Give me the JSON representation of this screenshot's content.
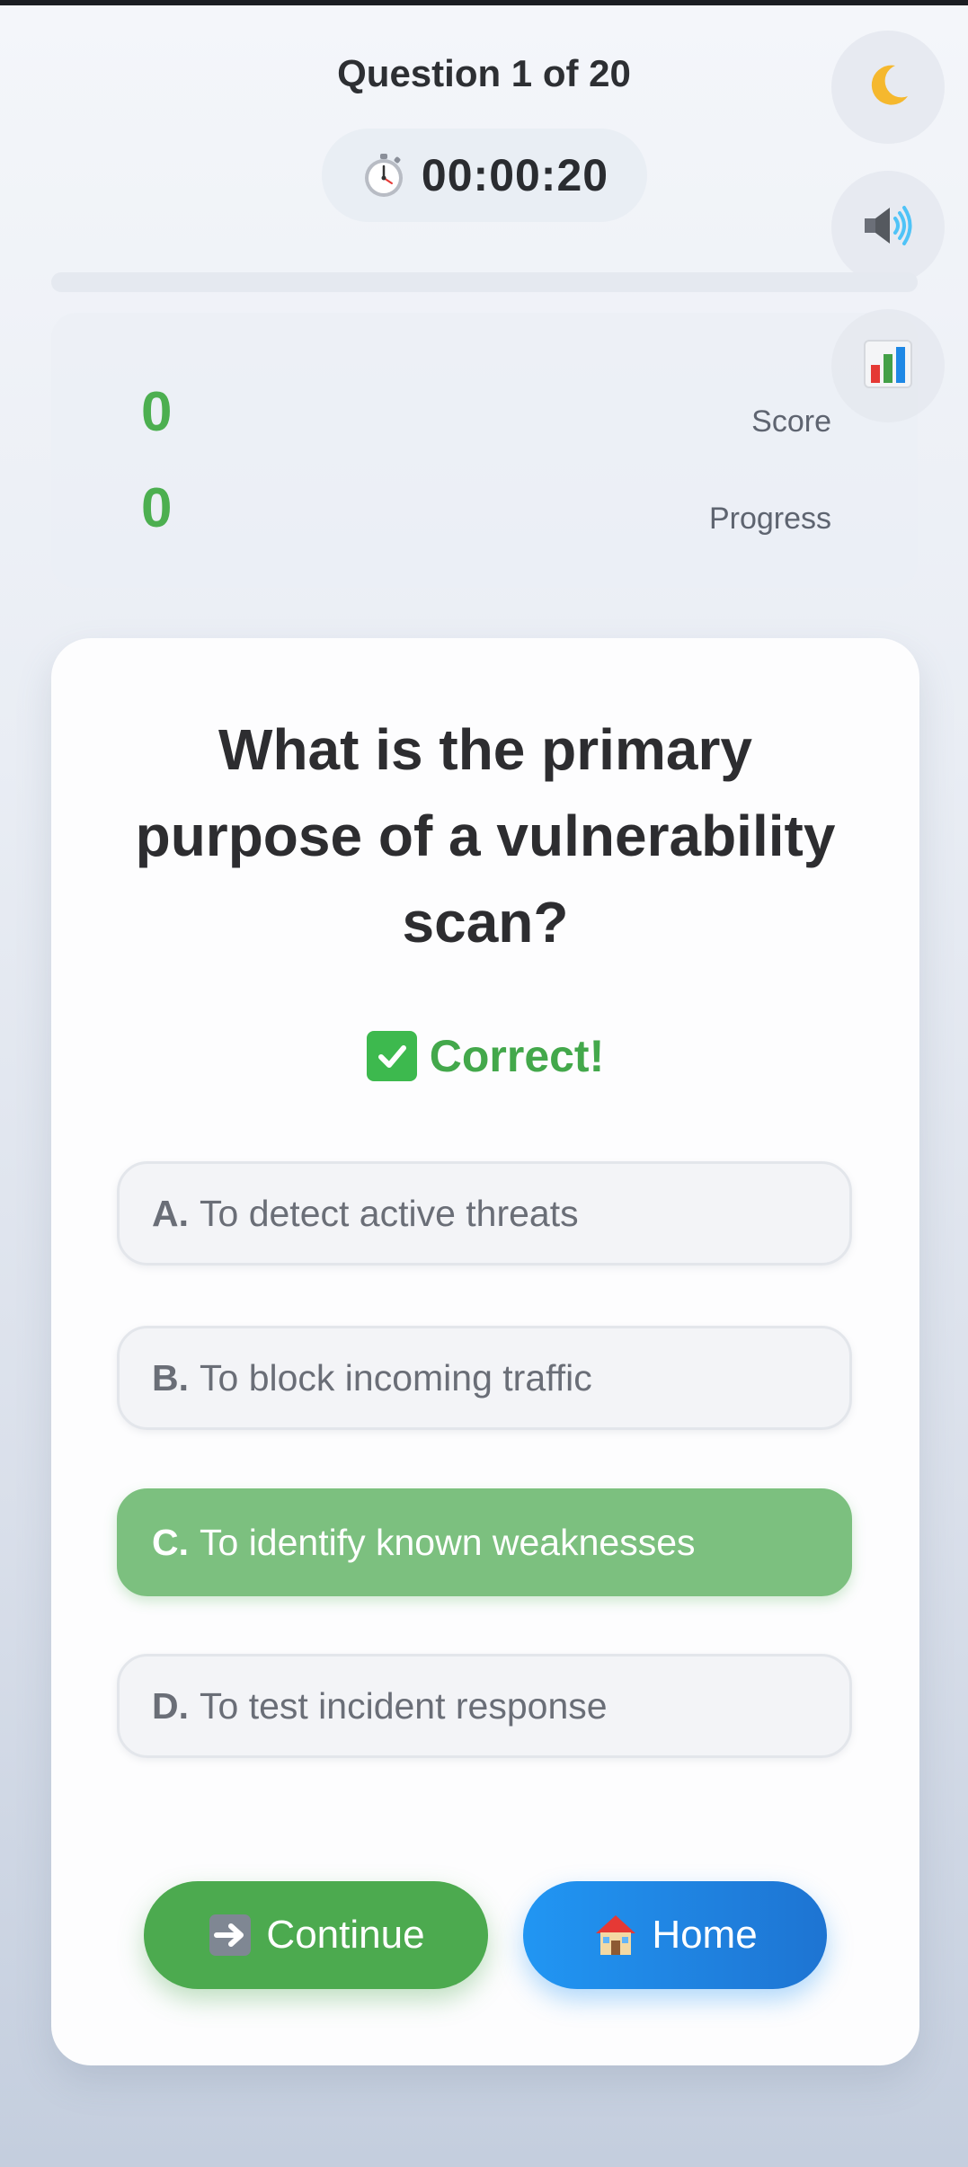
{
  "header": {
    "question_counter": "Question 1 of 20",
    "timer": "00:00:20",
    "timer_icon": "stopwatch-icon",
    "progress_fraction": 0.0
  },
  "toolbar": {
    "theme_icon": "crescent-moon-icon",
    "sound_icon": "speaker-icon",
    "stats_icon": "bar-chart-icon"
  },
  "stats": {
    "score_value": "0",
    "score_label": "Score",
    "progress_value": "0",
    "progress_label": "Progress"
  },
  "quiz": {
    "question": "What is the primary purpose of a vulnerability scan?",
    "feedback": "Correct!",
    "feedback_icon": "check-mark-icon",
    "options": [
      {
        "letter": "A.",
        "text": "To detect active threats",
        "state": "default"
      },
      {
        "letter": "B.",
        "text": "To block incoming traffic",
        "state": "default"
      },
      {
        "letter": "C.",
        "text": "To identify known weaknesses",
        "state": "correct"
      },
      {
        "letter": "D.",
        "text": "To test incident response",
        "state": "default"
      }
    ]
  },
  "actions": {
    "continue_label": "Continue",
    "continue_icon": "right-arrow-icon",
    "home_label": "Home",
    "home_icon": "house-icon"
  },
  "colors": {
    "correct_green": "#4caf50",
    "correct_option_bg": "#7cc07f",
    "home_blue": "#2196f3"
  }
}
